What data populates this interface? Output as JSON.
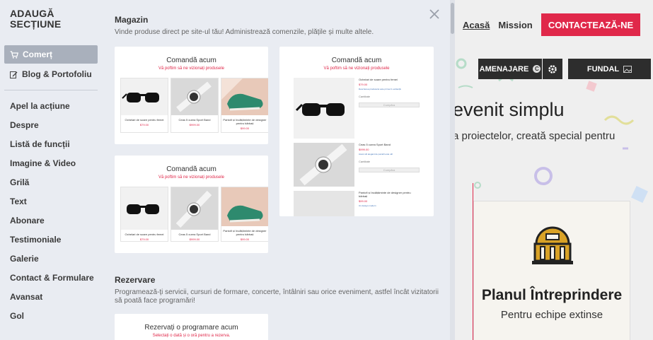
{
  "site": {
    "nav": [
      "Acasă",
      "Mission"
    ],
    "cta": "CONTACTEAZĂ-NE",
    "toolbar": {
      "design_label": "AMENAJARE",
      "design_badge": "C",
      "background_label": "FUNDAL"
    },
    "hero_title": "evenit simplu",
    "hero_subtitle": "a proiectelor, creată special pentru",
    "card": {
      "title": "Planul Întreprindere",
      "subtitle": "Pentru echipe extinse"
    }
  },
  "panel": {
    "heading_line1": "ADAUGĂ",
    "heading_line2": "SECȚIUNE",
    "categories_top": [
      {
        "label": "Comerț",
        "icon": "cart-icon"
      },
      {
        "label": "Blog & Portofoliu",
        "icon": "edit-icon"
      }
    ],
    "categories": [
      "Apel la acțiune",
      "Despre",
      "Listă de funcții",
      "Imagine & Video",
      "Grilă",
      "Text",
      "Abonare",
      "Testimoniale",
      "Galerie",
      "Contact & Formulare",
      "Avansat",
      "Gol"
    ],
    "sections": [
      {
        "title": "Magazin",
        "description": "Vinde produse direct pe site-ul tău! Administrează comenzile, plățile și multe altele."
      },
      {
        "title": "Rezervare",
        "description": "Programează-ți servicii, cursuri de formare, concerte, întâlniri sau orice eveniment, astfel încât vizitatorii să poată face programări!"
      }
    ],
    "store_templates": [
      {
        "title": "Comandă acum",
        "subtitle": "Vă poftim să ne vizionați produsele",
        "products": [
          {
            "name": "Ochelari de soare pentru femei",
            "price": "$79.00"
          },
          {
            "name": "Ceas 5 curea Sport Band",
            "price": "$999.00"
          },
          {
            "name": "Pantofi și încălțăminte de designer pentru bărbați",
            "price": "$99.00"
          }
        ]
      },
      {
        "title": "Comandă acum",
        "subtitle": "Vă poftim să ne vizionați produsele",
        "products": [
          {
            "name": "Ochelari de soare pentru femei",
            "price": "$79.00"
          },
          {
            "name": "Ceas 5 curea Sport Band",
            "price": "$999.00"
          },
          {
            "name": "Pantofi și încălțăminte de designer pentru bărbați",
            "price": "$99.00"
          }
        ]
      },
      {
        "title": "Comandă acum",
        "subtitle": "Vă poftim să ne vizionați produsele",
        "products": [
          {
            "name": "Ochelari de soare pentru femei",
            "price": "$79.00",
            "desc": "Descrierea produsului este prima în evidență"
          },
          {
            "name": "Ceas 5 curea Sport Band",
            "price": "$999.00",
            "desc": "Acest stil elegant de pantofi este util"
          },
          {
            "name": "Pantofi și încălțăminte de designer pentru bărbați",
            "price": "$99.00",
            "desc": "Un design modern"
          }
        ],
        "quantity_label": "Cantitate",
        "add_label": "Cumpăra"
      }
    ],
    "booking_template": {
      "title": "Rezervați o programare acum",
      "subtitle": "Selectați o dată și o oră pentru a rezerva."
    }
  },
  "colors": {
    "accent": "#e0284a",
    "panel_bg": "#e9ecf2",
    "active_item": "#a9b0bc",
    "dark_button": "#2d2d2d"
  }
}
